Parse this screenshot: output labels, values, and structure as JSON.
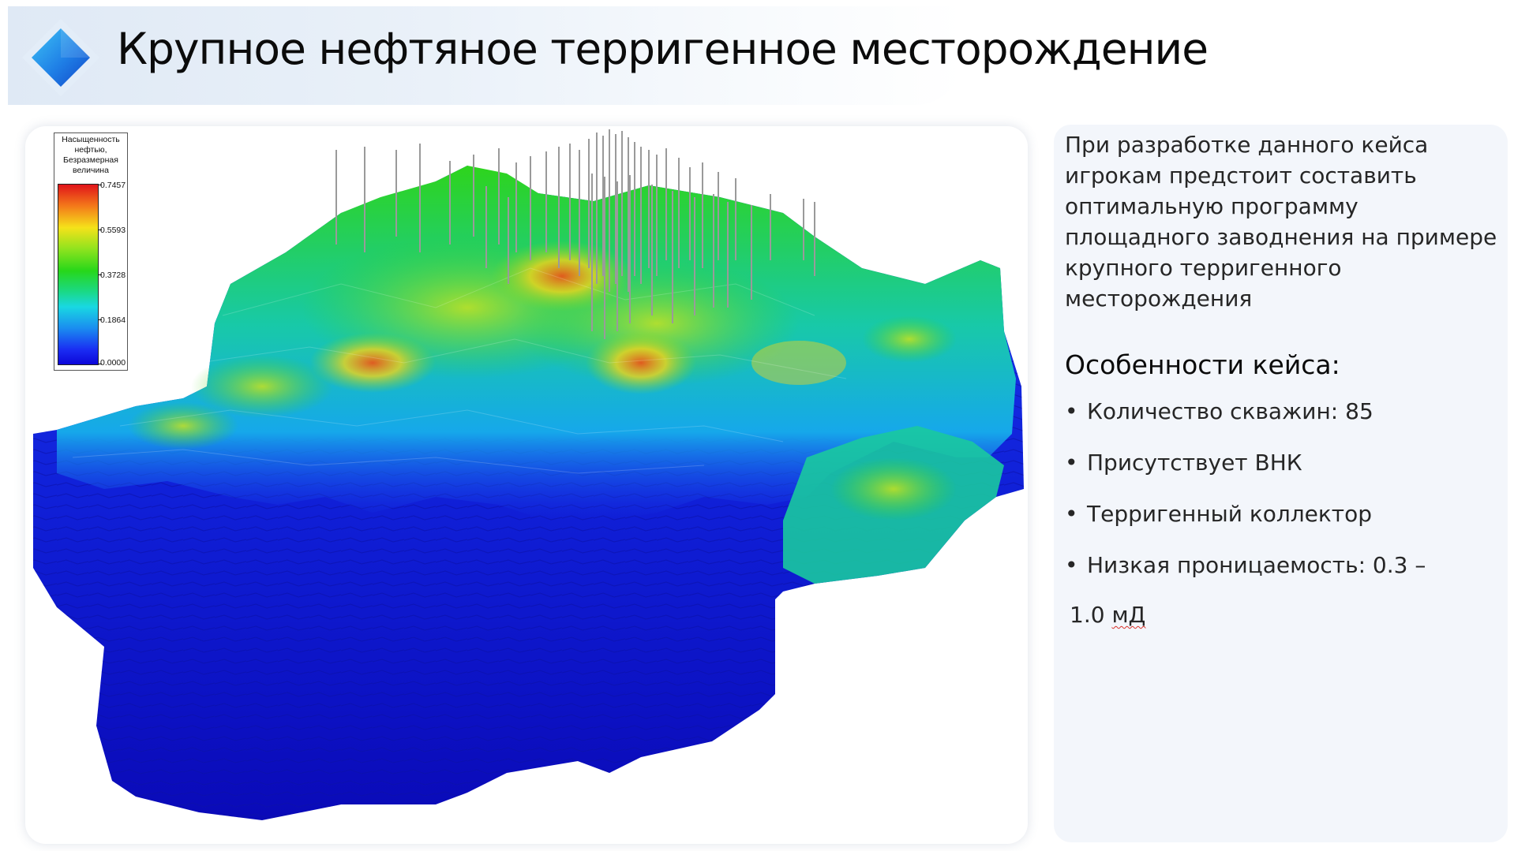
{
  "header": {
    "title": "Крупное нефтяное терригенное месторождение"
  },
  "model": {
    "legend": {
      "title_lines": [
        "Насыщенность",
        "нефтью,",
        "Безразмерная",
        "величина"
      ],
      "ticks": [
        "0.7457",
        "0.5593",
        "0.3728",
        "0.1864",
        "0.0000"
      ]
    },
    "colors": {
      "low": "#0d06d9",
      "mid": "#27d71a",
      "high": "#e0141a",
      "wells": "#9a9a9a"
    }
  },
  "info": {
    "intro": "При разработке данного кейса игрокам предстоит составить оптимальную программу площадного заводнения на примере крупного терригенного месторождения",
    "features_heading": "Особенности кейса:",
    "features": [
      "Количество скважин: 85",
      "Присутствует ВНК",
      "Терригенный коллектор",
      "Низкая проницаемость: 0.3 –"
    ],
    "feature_continuation_value": "1.0",
    "feature_continuation_unit": "мД",
    "bullet": "•"
  }
}
